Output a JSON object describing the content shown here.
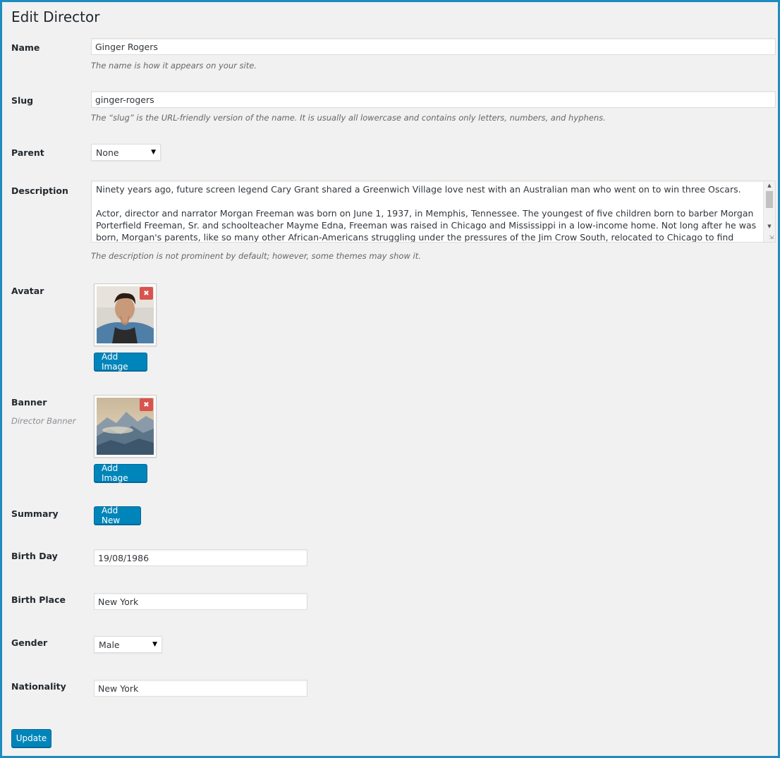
{
  "page": {
    "title": "Edit Director"
  },
  "fields": {
    "name": {
      "label": "Name",
      "value": "Ginger Rogers",
      "description": "The name is how it appears on your site."
    },
    "slug": {
      "label": "Slug",
      "value": "ginger-rogers",
      "description": "The “slug” is the URL-friendly version of the name. It is usually all lowercase and contains only letters, numbers, and hyphens."
    },
    "parent": {
      "label": "Parent",
      "selected": "None"
    },
    "description": {
      "label": "Description",
      "paragraph1": "Ninety years ago, future screen legend Cary Grant shared a Greenwich Village love nest with an Australian man who went on to win three Oscars.",
      "paragraph2": "Actor, director and narrator Morgan Freeman was born on June 1, 1937, in Memphis, Tennessee. The youngest of five children born to barber Morgan Porterfield Freeman, Sr. and schoolteacher Mayme Edna, Freeman was raised in Chicago and Mississippi in a low-income home. Not long after he was born, Morgan's parents, like so many other African-Americans struggling under the pressures of the Jim Crow South, relocated to Chicago to find work. While his parents looked for jobs, Freeman remained with his",
      "help": "The description is not prominent by default; however, some themes may show it."
    },
    "avatar": {
      "label": "Avatar",
      "button": "Add Image",
      "remove": "✖"
    },
    "banner": {
      "label": "Banner",
      "sublabel": "Director Banner",
      "button": "Add Image",
      "remove": "✖"
    },
    "summary": {
      "label": "Summary",
      "button": "Add New"
    },
    "birth_day": {
      "label": "Birth Day",
      "value": "19/08/1986"
    },
    "birth_place": {
      "label": "Birth Place",
      "value": "New York"
    },
    "gender": {
      "label": "Gender",
      "selected": "Male"
    },
    "nationality": {
      "label": "Nationality",
      "value": "New York"
    }
  },
  "actions": {
    "update": "Update"
  },
  "icons": {
    "dropdown": "chevron-down-icon",
    "remove": "close-icon"
  },
  "colors": {
    "primary_button": "#0085ba",
    "remove_button": "#d9534f",
    "frame_border": "#1e8cbe"
  }
}
